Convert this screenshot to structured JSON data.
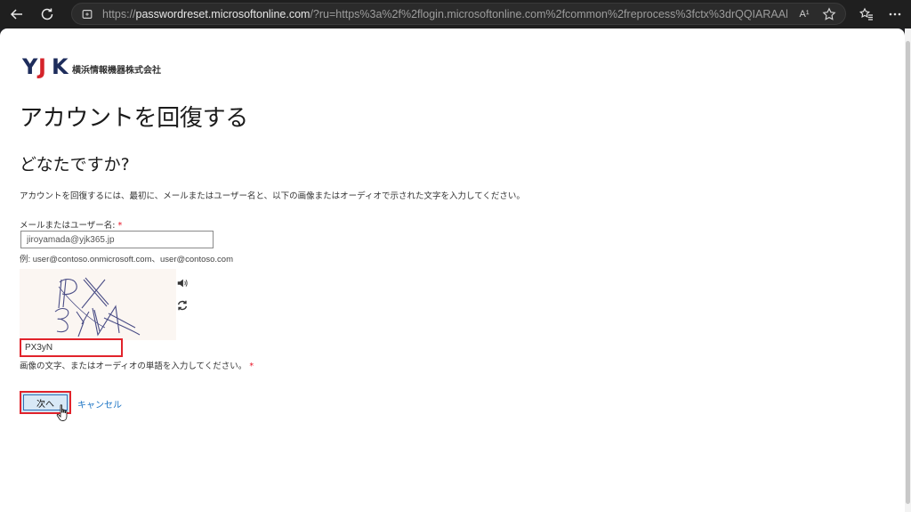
{
  "browser": {
    "url_prefix": "https://",
    "url_host": "passwordreset.microsoftonline.com",
    "url_rest": "/?ru=https%3a%2f%2flogin.microsoftonline.com%2fcommon%2freprocess%3fctx%3drQQIARAAhZI7jONkFI...",
    "read_aloud_label": "A¹"
  },
  "logo": {
    "mark_y": "Y",
    "mark_j": "J",
    "mark_k": "K",
    "company_name": "横浜情報機器株式会社"
  },
  "page": {
    "title": "アカウントを回復する",
    "section_title": "どなたですか?",
    "instructions": "アカウントを回復するには、最初に、メールまたはユーザー名と、以下の画像またはオーディオで示された文字を入力してください。"
  },
  "email": {
    "label": "メールまたはユーザー名: ",
    "required_mark": "*",
    "value": "jiroyamada@yjk365.jp",
    "example": "例: user@contoso.onmicrosoft.com、user@contoso.com"
  },
  "captcha": {
    "value": "PX3yN",
    "help": "画像の文字、またはオーディオの単語を入力してください。",
    "required_mark": "*"
  },
  "actions": {
    "next_label": "次へ",
    "cancel_label": "キャンセル"
  },
  "colors": {
    "highlight": "#e1232b",
    "link": "#1a73c4",
    "button_bg": "#d8e8f6"
  }
}
